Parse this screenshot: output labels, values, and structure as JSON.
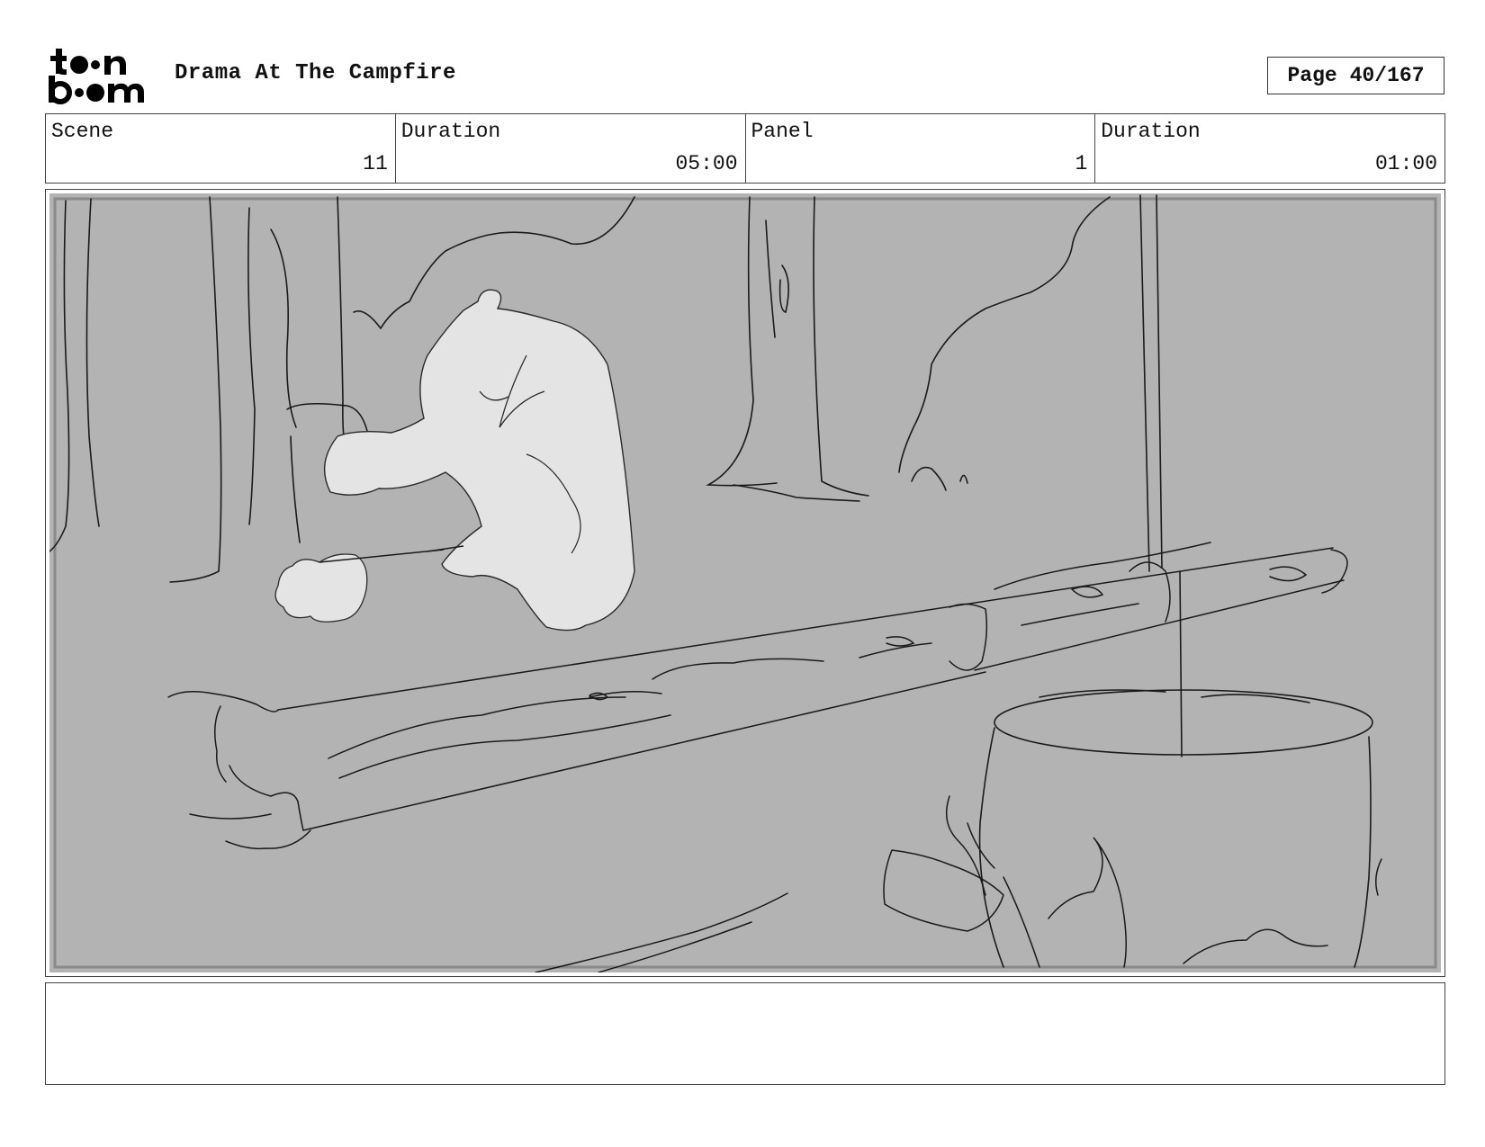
{
  "header": {
    "logo_alt": "toon boom",
    "project_title": "Drama At The Campfire",
    "page_label": "Page",
    "page_number": "40/167"
  },
  "info": {
    "scene_label": "Scene",
    "scene_value": "11",
    "scene_duration_label": "Duration",
    "scene_duration_value": "05:00",
    "panel_label": "Panel",
    "panel_value": "1",
    "panel_duration_label": "Duration",
    "panel_duration_value": "01:00"
  },
  "colors": {
    "panel_background": "#b3b3b3",
    "sketch_line": "#1a1a1a",
    "character_fill": "#e4e4e4"
  },
  "notes": {
    "text": ""
  }
}
